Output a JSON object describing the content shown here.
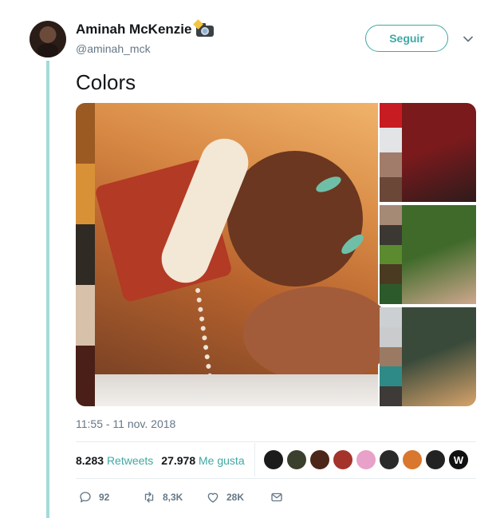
{
  "user": {
    "display_name": "Aminah McKenzie",
    "handle": "@aminah_mck",
    "badge_icon": "camera-with-flash-icon"
  },
  "follow_button_label": "Seguir",
  "tweet": {
    "text": "Colors",
    "timestamp": "11:55 - 11 nov. 2018"
  },
  "media": {
    "main_palette": [
      "#9a5a22",
      "#d99138",
      "#2f2a24",
      "#d8c1aa",
      "#4a1f18"
    ],
    "panels": [
      {
        "palette": [
          "#c71c22",
          "#e2e4e6",
          "#a27c6a",
          "#6b4738"
        ],
        "scene_colors": [
          "#7a1a1c",
          "#2e1b1b"
        ]
      },
      {
        "palette": [
          "#a58a76",
          "#3b3834",
          "#5b8a2f",
          "#4a3a22",
          "#2c5a2a"
        ],
        "scene_colors": [
          "#3f6a2a",
          "#cfa88e"
        ]
      },
      {
        "palette": [
          "#cdd0d2",
          "#c9cbcc",
          "#9b7a63",
          "#2e8a86",
          "#3d3a37"
        ],
        "scene_colors": [
          "#3a4a3a",
          "#d7a36b"
        ]
      }
    ]
  },
  "stats": {
    "retweets_count": "8.283",
    "retweets_label": "Retweets",
    "likes_count": "27.978",
    "likes_label": "Me gusta"
  },
  "likers": [
    {
      "name": "liker-avatar-1",
      "color": "#1b1b1b",
      "glyph": ""
    },
    {
      "name": "liker-avatar-2",
      "color": "#3a3f2e",
      "glyph": ""
    },
    {
      "name": "liker-avatar-3",
      "color": "#4b2619",
      "glyph": ""
    },
    {
      "name": "liker-avatar-4",
      "color": "#a4332c",
      "glyph": ""
    },
    {
      "name": "liker-avatar-5",
      "color": "#e8a1c9",
      "glyph": ""
    },
    {
      "name": "liker-avatar-6",
      "color": "#2a2a2a",
      "glyph": ""
    },
    {
      "name": "liker-avatar-7",
      "color": "#d9772e",
      "glyph": ""
    },
    {
      "name": "liker-avatar-8",
      "color": "#222222",
      "glyph": ""
    },
    {
      "name": "liker-avatar-9",
      "color": "#111111",
      "glyph": "W"
    }
  ],
  "actions": {
    "replies": "92",
    "retweets": "8,3K",
    "likes": "28K"
  },
  "colors": {
    "accent": "#3fa8a4",
    "thread_line": "#a3dbd9",
    "muted_text": "#657786"
  }
}
